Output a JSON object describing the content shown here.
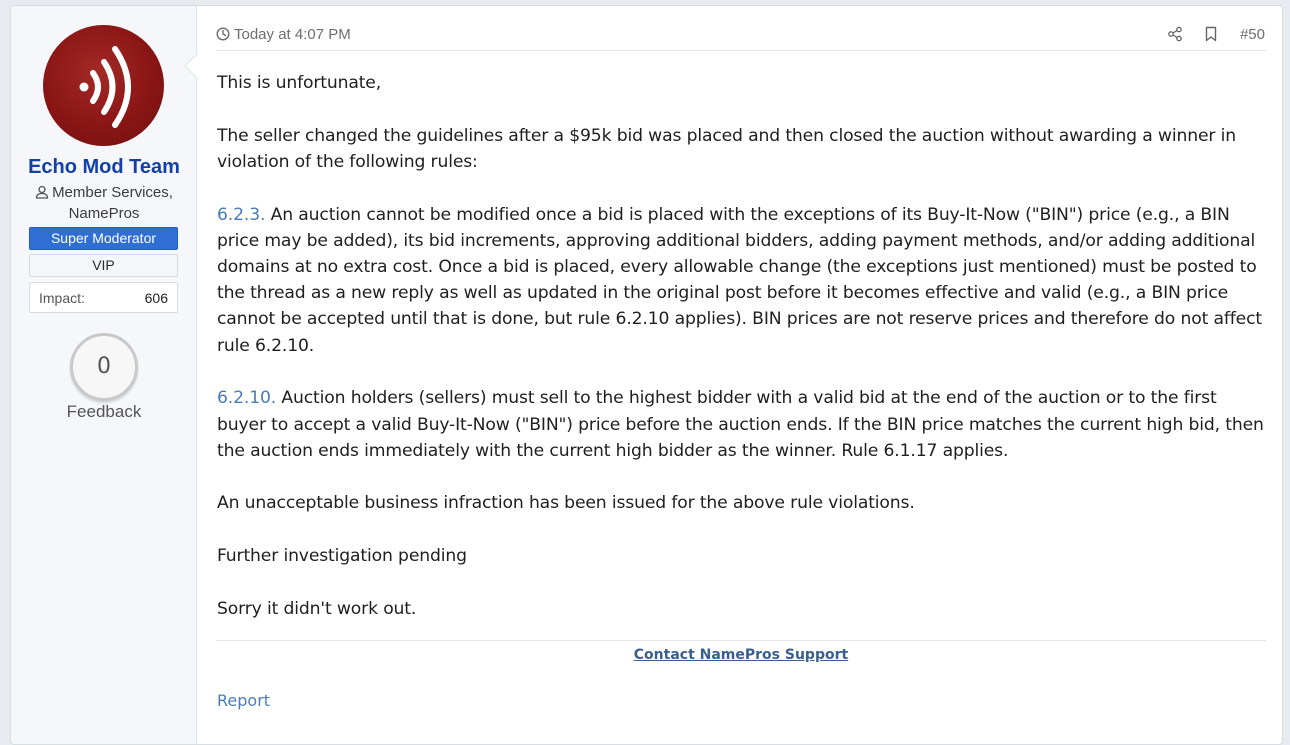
{
  "author": {
    "name": "Echo Mod Team",
    "title": "Member Services, NamePros",
    "banners": [
      "Super Moderator",
      "VIP"
    ],
    "impact_label": "Impact:",
    "impact_value": "606",
    "feedback_count": "0",
    "feedback_label": "Feedback",
    "avatar_icon": "sound-waves-icon",
    "avatar_color": "#8a1515"
  },
  "post": {
    "time": "Today at 4:07 PM",
    "number": "#50",
    "paragraphs": [
      {
        "text": "This is unfortunate,"
      },
      {
        "text": "The seller changed the guidelines after a $95k bid was placed and then closed the auction without awarding a winner in violation of the following rules:"
      },
      {
        "rule": "6.2.3.",
        "text": " An auction cannot be modified once a bid is placed with the exceptions of its Buy-It-Now (\"BIN\") price (e.g., a BIN price may be added), its bid increments, approving additional bidders, adding payment methods, and/or adding additional domains at no extra cost. Once a bid is placed, every allowable change (the exceptions just mentioned) must be posted to the thread as a new reply as well as updated in the original post before it becomes effective and valid (e.g., a BIN price cannot be accepted until that is done, but rule 6.2.10 applies). BIN prices are not reserve prices and therefore do not affect rule 6.2.10."
      },
      {
        "rule": "6.2.10.",
        "text": " Auction holders (sellers) must sell to the highest bidder with a valid bid at the end of the auction or to the first buyer to accept a valid Buy-It-Now (\"BIN\") price before the auction ends. If the BIN price matches the current high bid, then the auction ends immediately with the current high bidder as the winner. Rule 6.1.17 applies."
      },
      {
        "text": "An unacceptable business infraction has been issued for the above rule violations."
      },
      {
        "text": "Further investigation pending"
      },
      {
        "text": "Sorry it didn't work out."
      }
    ],
    "signature_link": "Contact NamePros Support",
    "report_label": "Report"
  },
  "colors": {
    "username": "#1340a8",
    "moderator_banner": "#2f6fd3",
    "link": "#4a7db8"
  }
}
